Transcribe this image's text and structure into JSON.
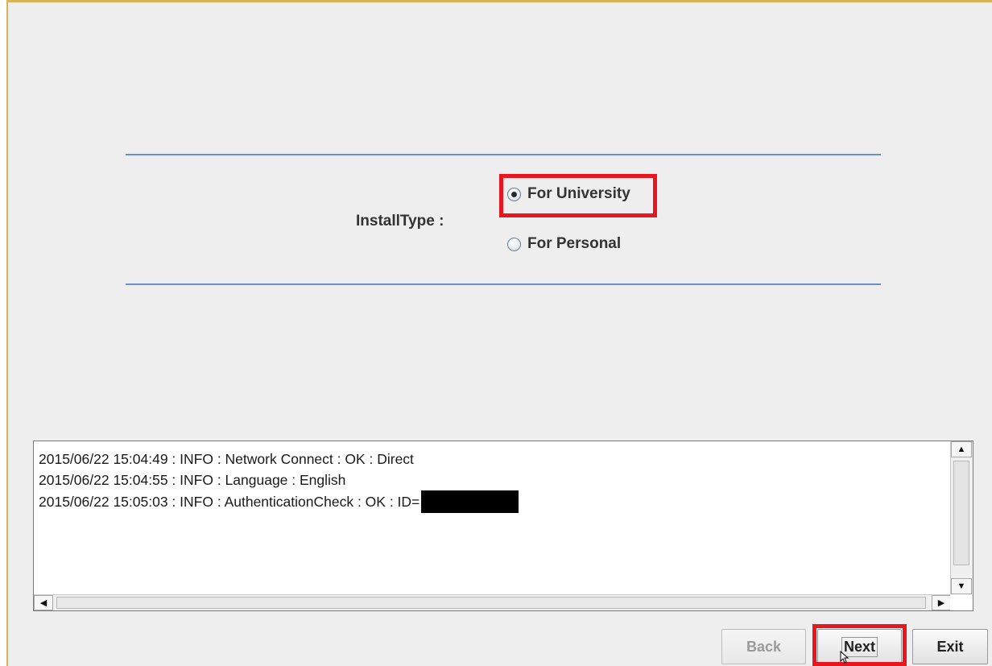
{
  "form": {
    "install_type_label": "InstallType :",
    "options": [
      {
        "label": "For University",
        "selected": true
      },
      {
        "label": "For Personal",
        "selected": false
      }
    ]
  },
  "log": {
    "lines": [
      "2015/06/22 15:04:49 : INFO  : Network Connect : OK : Direct",
      "2015/06/22 15:04:55 : INFO  : Language : English",
      "2015/06/22 15:05:03 : INFO  : AuthenticationCheck : OK : ID="
    ]
  },
  "buttons": {
    "back": "Back",
    "next": "Next",
    "exit": "Exit"
  },
  "colors": {
    "highlight": "#e8161f",
    "separator": "#6d8fc7",
    "background": "#eeeeee"
  }
}
